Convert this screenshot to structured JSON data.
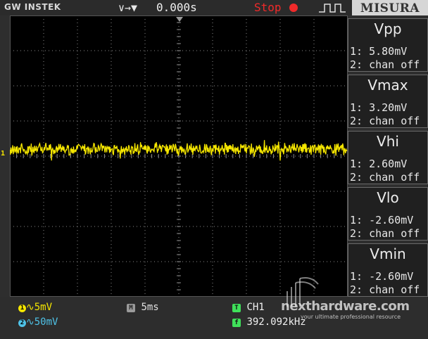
{
  "header": {
    "brand": "GW INSTEK",
    "trigger_mode_symbol": "∨→▼",
    "time_offset": "0.000s",
    "run_state": "Stop",
    "banner": "MISURA"
  },
  "channel_marker": "1",
  "measurements": [
    {
      "name": "Vpp",
      "ch1": "1: 5.80mV",
      "ch2": "2: chan off"
    },
    {
      "name": "Vmax",
      "ch1": "1: 3.20mV",
      "ch2": "2: chan off"
    },
    {
      "name": "Vhi",
      "ch1": "1: 2.60mV",
      "ch2": "2: chan off"
    },
    {
      "name": "Vlo",
      "ch1": "1: -2.60mV",
      "ch2": "2: chan off"
    },
    {
      "name": "Vmin",
      "ch1": "1: -2.60mV",
      "ch2": "2: chan off"
    }
  ],
  "status": {
    "ch1_badge": "1",
    "ch1_scale": "∿5mV",
    "ch2_badge": "2",
    "ch2_scale": "∿50mV",
    "timebase_badge": "M",
    "timebase": "5ms",
    "trigger_badge": "T",
    "trigger_source": "CH1",
    "freq_badge": "f",
    "frequency": "392.092kHz"
  },
  "watermark": {
    "main": "nexthardware.com",
    "sub": "your ultimate professional resource"
  },
  "colors": {
    "ch1": "#f5e600",
    "ch2": "#4fc3e8",
    "stop": "#f02a2a",
    "grid": "#8a8a8a",
    "screen": "#000000"
  }
}
